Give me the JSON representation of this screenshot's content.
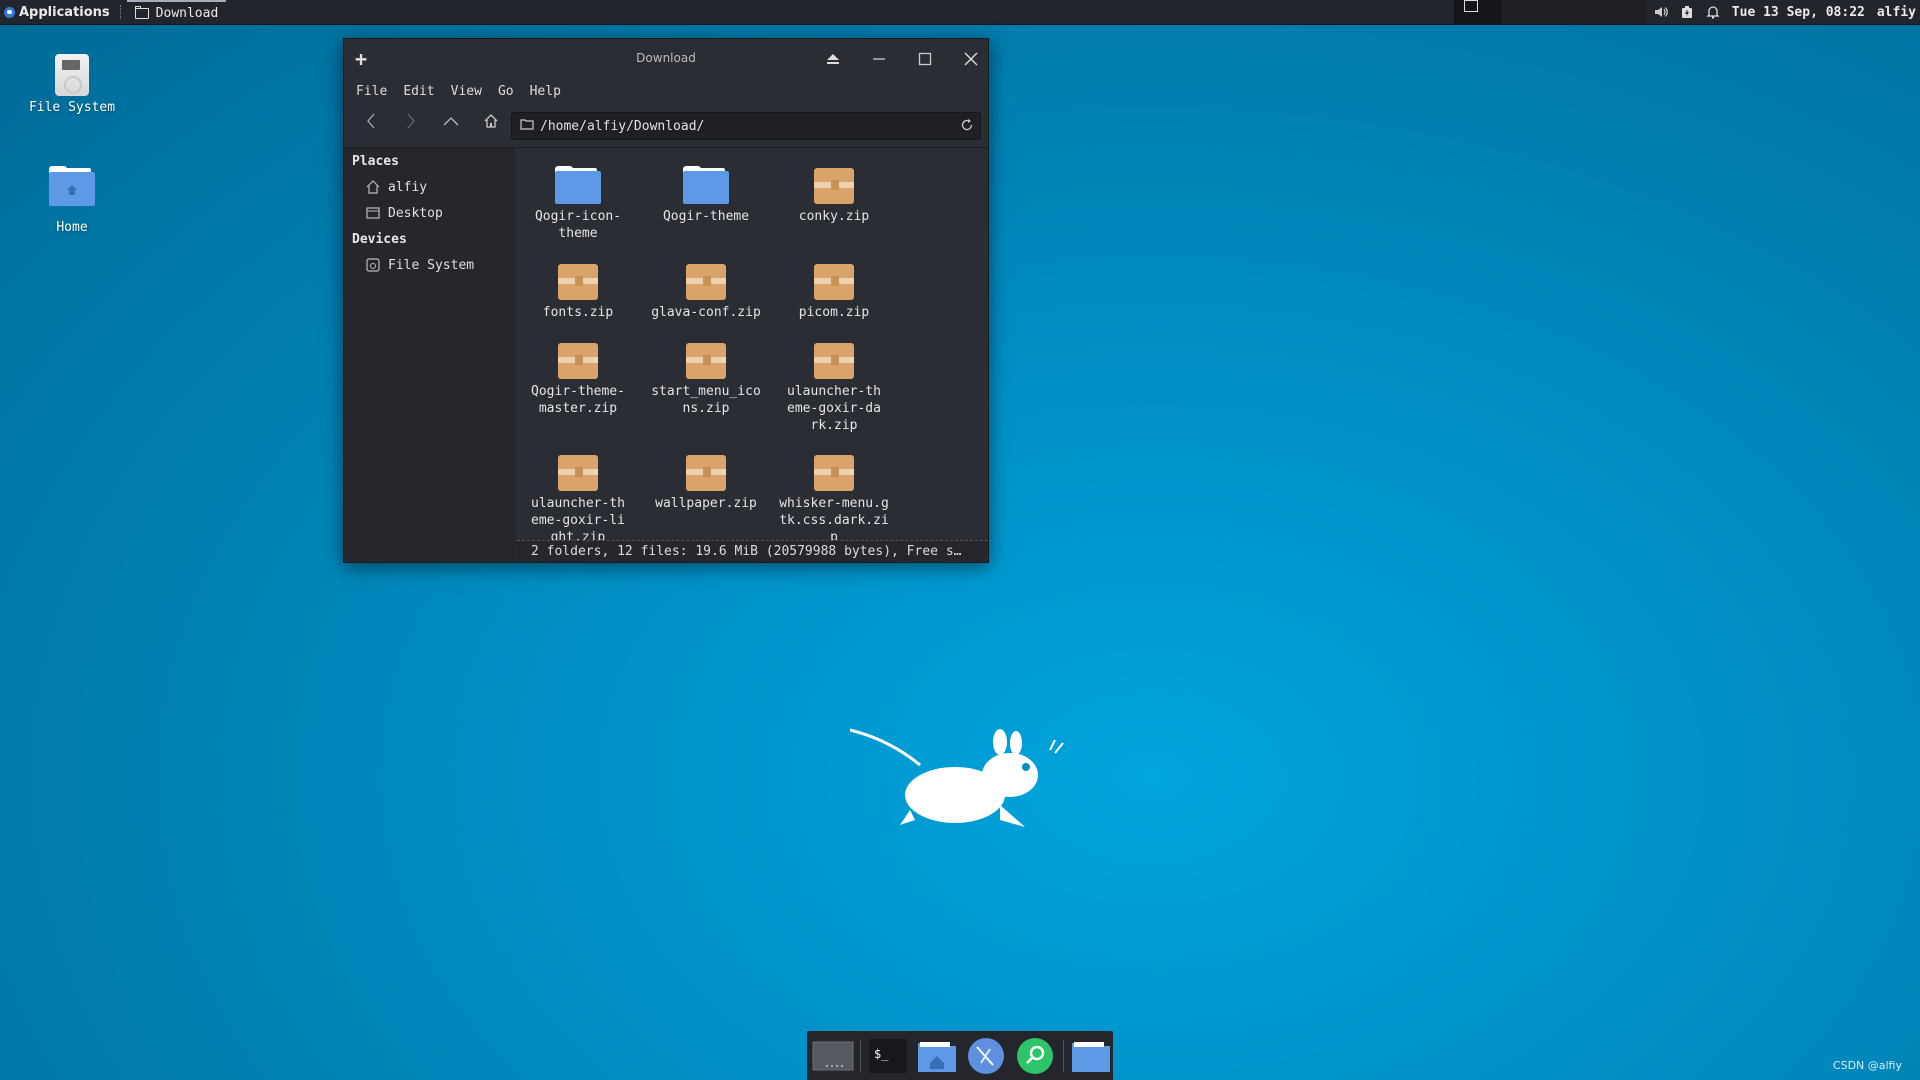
{
  "top_panel": {
    "applications_label": "Applications",
    "task_title": "Download",
    "clock": "Tue 13 Sep, 08:22",
    "user": "alfiy"
  },
  "desktop": {
    "icons": [
      {
        "label": "File System",
        "icon": "drive-icon"
      },
      {
        "label": "Home",
        "icon": "home-folder-icon"
      }
    ]
  },
  "window": {
    "title": "Download",
    "menu": [
      "File",
      "Edit",
      "View",
      "Go",
      "Help"
    ],
    "location": "/home/alfiy/Download/",
    "sidebar": {
      "places_header": "Places",
      "places": [
        "alfiy",
        "Desktop"
      ],
      "devices_header": "Devices",
      "devices": [
        "File System"
      ]
    },
    "files": [
      {
        "name": "Qogir-icon-theme",
        "type": "folder"
      },
      {
        "name": "Qogir-theme",
        "type": "folder"
      },
      {
        "name": "conky.zip",
        "type": "zip"
      },
      {
        "name": "fonts.zip",
        "type": "zip"
      },
      {
        "name": "glava-conf.zip",
        "type": "zip"
      },
      {
        "name": "picom.zip",
        "type": "zip"
      },
      {
        "name": "Qogir-theme-master.zip",
        "type": "zip"
      },
      {
        "name": "start_menu_icons.zip",
        "type": "zip"
      },
      {
        "name": "ulauncher-theme-goxir-dark.zip",
        "type": "zip"
      },
      {
        "name": "ulauncher-theme-goxir-light.zip",
        "type": "zip"
      },
      {
        "name": "wallpaper.zip",
        "type": "zip"
      },
      {
        "name": "whisker-menu.gtk.css.dark.zip",
        "type": "zip"
      }
    ],
    "status": "2 folders, 12 files: 19.6 MiB (20579988 bytes), Free s…"
  },
  "dock": {
    "items": [
      "workspace-icon",
      "terminal-icon",
      "file-manager-icon",
      "web-browser-icon",
      "app-finder-icon",
      "folder-icon"
    ]
  },
  "watermark": "CSDN @alfiy",
  "colors": {
    "desktop_bg": "#0090c6",
    "panel_bg": "#23252c",
    "window_bg": "#2b2d34",
    "folder_blue": "#5e99e8",
    "zip_tan": "#d9a36a"
  }
}
